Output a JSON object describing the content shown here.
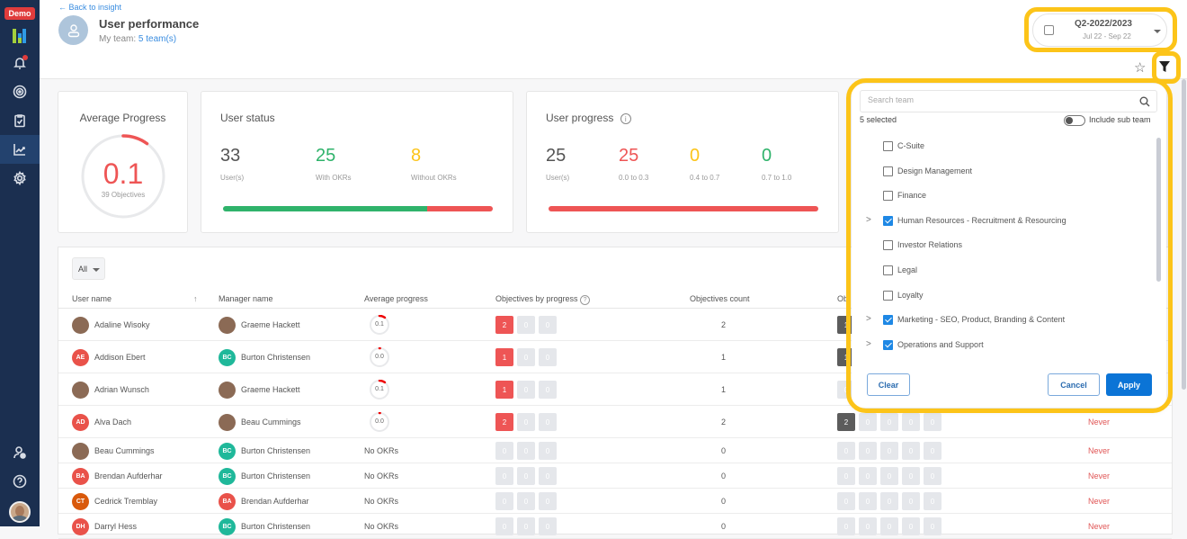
{
  "sidebar": {
    "badge": "Demo",
    "items": [
      {
        "name": "notifications",
        "icon": "bell-icon"
      },
      {
        "name": "objectives",
        "icon": "target-icon"
      },
      {
        "name": "checkins",
        "icon": "clipboard-check-icon"
      },
      {
        "name": "insights",
        "icon": "chart-line-icon",
        "active": true
      },
      {
        "name": "settings",
        "icon": "gear-icon"
      }
    ],
    "bottom": [
      {
        "name": "invite-user",
        "icon": "user-plus-icon"
      },
      {
        "name": "help",
        "icon": "help-circle-icon"
      }
    ]
  },
  "header": {
    "back_link": "← Back to insight",
    "title": "User performance",
    "subtitle_label": "My team:",
    "subtitle_value": "5 team(s)",
    "period": {
      "label": "Q2-2022/2023",
      "range": "Jul 22 - Sep 22"
    }
  },
  "average_progress": {
    "title": "Average Progress",
    "value": "0.1",
    "progress_fraction": 0.1,
    "subtitle": "39 Objectives"
  },
  "user_status": {
    "title": "User status",
    "stats": [
      {
        "value": "33",
        "label": "User(s)",
        "color": "#555555"
      },
      {
        "value": "25",
        "label": "With OKRs",
        "color": "#2fb36b"
      },
      {
        "value": "8",
        "label": "Without OKRs",
        "color": "#fcc419"
      }
    ],
    "bar": [
      {
        "fraction": 0.758,
        "color": "#2fb36b"
      },
      {
        "fraction": 0.242,
        "color": "#ee5555"
      }
    ]
  },
  "user_progress": {
    "title": "User progress",
    "stats": [
      {
        "value": "25",
        "label": "User(s)",
        "color": "#555555"
      },
      {
        "value": "25",
        "label": "0.0 to 0.3",
        "color": "#ee5555"
      },
      {
        "value": "0",
        "label": "0.4 to 0.7",
        "color": "#fcc419"
      },
      {
        "value": "0",
        "label": "0.7 to 1.0",
        "color": "#2fb36b"
      }
    ],
    "bar": [
      {
        "fraction": 1.0,
        "color": "#ee5555"
      }
    ]
  },
  "table": {
    "filter": "All",
    "columns": [
      "User name",
      "Manager name",
      "Average progress",
      "Objectives by progress",
      "Objectives count",
      "Obj"
    ],
    "rows": [
      {
        "user": "Adaline Wisoky",
        "user_initials": "",
        "user_color": "",
        "manager": "Graeme Hackett",
        "manager_initials": "",
        "manager_color": "",
        "avg": "0.1",
        "avg_fraction": 0.1,
        "by_progress": [
          2,
          0,
          0
        ],
        "count": "2",
        "status": [
          1
        ],
        "last": ""
      },
      {
        "user": "Addison Ebert",
        "user_initials": "AE",
        "user_color": "#e9524a",
        "manager": "Burton Christensen",
        "manager_initials": "BC",
        "manager_color": "#1fb89a",
        "avg": "0.0",
        "avg_fraction": 0.0,
        "by_progress": [
          1,
          0,
          0
        ],
        "count": "1",
        "status": [
          1
        ],
        "last": ""
      },
      {
        "user": "Adrian Wunsch",
        "user_initials": "",
        "user_color": "",
        "manager": "Graeme Hackett",
        "manager_initials": "",
        "manager_color": "",
        "avg": "0.1",
        "avg_fraction": 0.1,
        "by_progress": [
          1,
          0,
          0
        ],
        "count": "1",
        "status": [
          0
        ],
        "last": ""
      },
      {
        "user": "Alva Dach",
        "user_initials": "AD",
        "user_color": "#e9524a",
        "manager": "Beau Cummings",
        "manager_initials": "",
        "manager_color": "",
        "avg": "0.0",
        "avg_fraction": 0.0,
        "by_progress": [
          2,
          0,
          0
        ],
        "count": "2",
        "status": [
          2,
          0,
          0,
          0,
          0
        ],
        "last": "Never"
      },
      {
        "user": "Beau Cummings",
        "user_initials": "",
        "user_color": "",
        "manager": "Burton Christensen",
        "manager_initials": "BC",
        "manager_color": "#1fb89a",
        "avg": "No OKRs",
        "avg_fraction": null,
        "by_progress": [
          0,
          0,
          0
        ],
        "count": "0",
        "status": [
          0,
          0,
          0,
          0,
          0
        ],
        "last": "Never"
      },
      {
        "user": "Brendan Aufderhar",
        "user_initials": "BA",
        "user_color": "#e9524a",
        "manager": "Burton Christensen",
        "manager_initials": "BC",
        "manager_color": "#1fb89a",
        "avg": "No OKRs",
        "avg_fraction": null,
        "by_progress": [
          0,
          0,
          0
        ],
        "count": "0",
        "status": [
          0,
          0,
          0,
          0,
          0
        ],
        "last": "Never"
      },
      {
        "user": "Cedrick Tremblay",
        "user_initials": "CT",
        "user_color": "#d9590b",
        "manager": "Brendan Aufderhar",
        "manager_initials": "BA",
        "manager_color": "#e9524a",
        "avg": "No OKRs",
        "avg_fraction": null,
        "by_progress": [
          0,
          0,
          0
        ],
        "count": "0",
        "status": [
          0,
          0,
          0,
          0,
          0
        ],
        "last": "Never"
      },
      {
        "user": "Darryl Hess",
        "user_initials": "DH",
        "user_color": "#e9524a",
        "manager": "Burton Christensen",
        "manager_initials": "BC",
        "manager_color": "#1fb89a",
        "avg": "No OKRs",
        "avg_fraction": null,
        "by_progress": [
          0,
          0,
          0
        ],
        "count": "0",
        "status": [
          0,
          0,
          0,
          0,
          0
        ],
        "last": "Never"
      }
    ]
  },
  "team_filter": {
    "search_placeholder": "Search team",
    "selected_text": "5 selected",
    "include_sub_team": "Include sub team",
    "teams": [
      {
        "name": "C-Suite",
        "checked": false,
        "expandable": false
      },
      {
        "name": "Design Management",
        "checked": false,
        "expandable": false
      },
      {
        "name": "Finance",
        "checked": false,
        "expandable": false
      },
      {
        "name": "Human Resources - Recruitment & Resourcing",
        "checked": true,
        "expandable": true
      },
      {
        "name": "Investor Relations",
        "checked": false,
        "expandable": false
      },
      {
        "name": "Legal",
        "checked": false,
        "expandable": false
      },
      {
        "name": "Loyalty",
        "checked": false,
        "expandable": false
      },
      {
        "name": "Marketing - SEO, Product, Branding & Content",
        "checked": true,
        "expandable": true
      },
      {
        "name": "Operations and Support",
        "checked": true,
        "expandable": true
      }
    ],
    "clear_label": "Clear",
    "cancel_label": "Cancel",
    "apply_label": "Apply"
  }
}
